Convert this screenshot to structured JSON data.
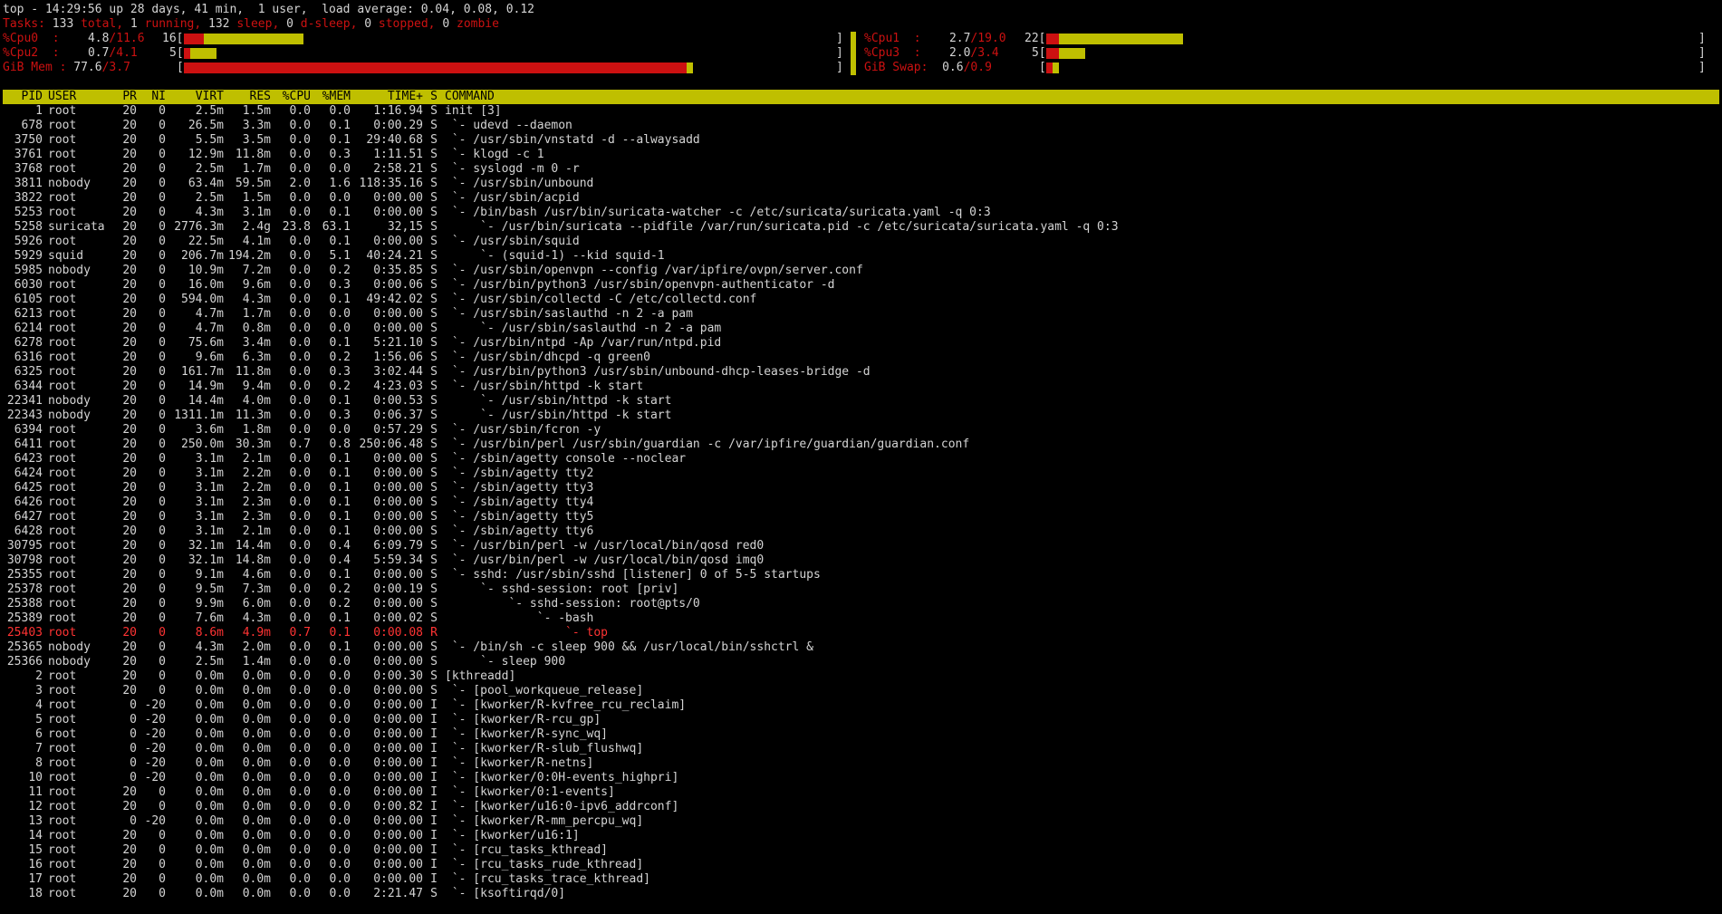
{
  "summary": {
    "uptime_line": "top - 14:29:56 up 28 days, 41 min,  1 user,  load average: 0.04, 0.08, 0.12",
    "tasks": {
      "label": "Tasks:",
      "total": "133",
      "total_l": "total,",
      "running": "1",
      "running_l": "running,",
      "sleep": "132",
      "sleep_l": "sleep,",
      "dsleep": "0",
      "dsleep_l": "d-sleep,",
      "stopped": "0",
      "stopped_l": "stopped,",
      "zombie": "0",
      "zombie_l": "zombie"
    }
  },
  "meters": {
    "cpu0": {
      "label": "%Cpu0  :",
      "value": "4.8",
      "sep": "/",
      "total": "11.6",
      "scale": "16[",
      "end": "]"
    },
    "cpu1": {
      "label": "%Cpu1  :",
      "value": "2.7",
      "sep": "/",
      "total": "19.0",
      "scale": "22[",
      "end": "]"
    },
    "cpu2": {
      "label": "%Cpu2  :",
      "value": "0.7",
      "sep": "/",
      "total": "4.1",
      "scale": "5[",
      "end": "]"
    },
    "cpu3": {
      "label": "%Cpu3  :",
      "value": "2.0",
      "sep": "/",
      "total": "3.4",
      "scale": "5[",
      "end": "]"
    },
    "mem": {
      "label": "GiB Mem :",
      "value": "77.6",
      "sep": "/",
      "total": "3.7",
      "scale": "[",
      "end": "]"
    },
    "swap": {
      "label": "GiB Swap:",
      "value": "0.6",
      "sep": "/",
      "total": "0.9",
      "scale": "[",
      "end": "]"
    }
  },
  "meter_levels": {
    "cpu0": {
      "user_frac": 0.03,
      "system_frac": 0.15
    },
    "cpu1": {
      "user_frac": 0.02,
      "system_frac": 0.19
    },
    "cpu2": {
      "user_frac": 0.01,
      "system_frac": 0.04
    },
    "cpu3": {
      "user_frac": 0.02,
      "system_frac": 0.04
    },
    "mem": {
      "user_frac": 0.76,
      "system_frac": 0.01
    },
    "swap": {
      "user_frac": 0.01,
      "system_frac": 0.01
    }
  },
  "colors": {
    "bar_red": "#cc1111",
    "bar_yellow": "#bfbf00",
    "header_bg": "#bfbf00",
    "text": "#d4d4d4",
    "current_row": "#ff3333"
  },
  "columns": [
    "PID",
    "USER",
    "PR",
    "NI",
    "VIRT",
    "RES",
    "%CPU",
    "%MEM",
    "TIME+",
    "S",
    "COMMAND"
  ],
  "processes": [
    [
      "1",
      "root",
      "20",
      "0",
      "2.5m",
      "1.5m",
      "0.0",
      "0.0",
      "1:16.94",
      "S",
      "init [3]"
    ],
    [
      "678",
      "root",
      "20",
      "0",
      "26.5m",
      "3.3m",
      "0.0",
      "0.1",
      "0:00.29",
      "S",
      " `- udevd --daemon"
    ],
    [
      "3750",
      "root",
      "20",
      "0",
      "5.5m",
      "3.5m",
      "0.0",
      "0.1",
      "29:40.68",
      "S",
      " `- /usr/sbin/vnstatd -d --alwaysadd"
    ],
    [
      "3761",
      "root",
      "20",
      "0",
      "12.9m",
      "11.8m",
      "0.0",
      "0.3",
      "1:11.51",
      "S",
      " `- klogd -c 1"
    ],
    [
      "3768",
      "root",
      "20",
      "0",
      "2.5m",
      "1.7m",
      "0.0",
      "0.0",
      "2:58.21",
      "S",
      " `- syslogd -m 0 -r"
    ],
    [
      "3811",
      "nobody",
      "20",
      "0",
      "63.4m",
      "59.5m",
      "2.0",
      "1.6",
      "118:35.16",
      "S",
      " `- /usr/sbin/unbound"
    ],
    [
      "3822",
      "root",
      "20",
      "0",
      "2.5m",
      "1.5m",
      "0.0",
      "0.0",
      "0:00.00",
      "S",
      " `- /usr/sbin/acpid"
    ],
    [
      "5253",
      "root",
      "20",
      "0",
      "4.3m",
      "3.1m",
      "0.0",
      "0.1",
      "0:00.00",
      "S",
      " `- /bin/bash /usr/bin/suricata-watcher -c /etc/suricata/suricata.yaml -q 0:3"
    ],
    [
      "5258",
      "suricata",
      "20",
      "0",
      "2776.3m",
      "2.4g",
      "23.8",
      "63.1",
      "32,15",
      "S",
      "     `- /usr/bin/suricata --pidfile /var/run/suricata.pid -c /etc/suricata/suricata.yaml -q 0:3"
    ],
    [
      "5926",
      "root",
      "20",
      "0",
      "22.5m",
      "4.1m",
      "0.0",
      "0.1",
      "0:00.00",
      "S",
      " `- /usr/sbin/squid"
    ],
    [
      "5929",
      "squid",
      "20",
      "0",
      "206.7m",
      "194.2m",
      "0.0",
      "5.1",
      "40:24.21",
      "S",
      "     `- (squid-1) --kid squid-1"
    ],
    [
      "5985",
      "nobody",
      "20",
      "0",
      "10.9m",
      "7.2m",
      "0.0",
      "0.2",
      "0:35.85",
      "S",
      " `- /usr/sbin/openvpn --config /var/ipfire/ovpn/server.conf"
    ],
    [
      "6030",
      "root",
      "20",
      "0",
      "16.0m",
      "9.6m",
      "0.0",
      "0.3",
      "0:00.06",
      "S",
      " `- /usr/bin/python3 /usr/sbin/openvpn-authenticator -d"
    ],
    [
      "6105",
      "root",
      "20",
      "0",
      "594.0m",
      "4.3m",
      "0.0",
      "0.1",
      "49:42.02",
      "S",
      " `- /usr/sbin/collectd -C /etc/collectd.conf"
    ],
    [
      "6213",
      "root",
      "20",
      "0",
      "4.7m",
      "1.7m",
      "0.0",
      "0.0",
      "0:00.00",
      "S",
      " `- /usr/sbin/saslauthd -n 2 -a pam"
    ],
    [
      "6214",
      "root",
      "20",
      "0",
      "4.7m",
      "0.8m",
      "0.0",
      "0.0",
      "0:00.00",
      "S",
      "     `- /usr/sbin/saslauthd -n 2 -a pam"
    ],
    [
      "6278",
      "root",
      "20",
      "0",
      "75.6m",
      "3.4m",
      "0.0",
      "0.1",
      "5:21.10",
      "S",
      " `- /usr/bin/ntpd -Ap /var/run/ntpd.pid"
    ],
    [
      "6316",
      "root",
      "20",
      "0",
      "9.6m",
      "6.3m",
      "0.0",
      "0.2",
      "1:56.06",
      "S",
      " `- /usr/sbin/dhcpd -q green0"
    ],
    [
      "6325",
      "root",
      "20",
      "0",
      "161.7m",
      "11.8m",
      "0.0",
      "0.3",
      "3:02.44",
      "S",
      " `- /usr/bin/python3 /usr/sbin/unbound-dhcp-leases-bridge -d"
    ],
    [
      "6344",
      "root",
      "20",
      "0",
      "14.9m",
      "9.4m",
      "0.0",
      "0.2",
      "4:23.03",
      "S",
      " `- /usr/sbin/httpd -k start"
    ],
    [
      "22341",
      "nobody",
      "20",
      "0",
      "14.4m",
      "4.0m",
      "0.0",
      "0.1",
      "0:00.53",
      "S",
      "     `- /usr/sbin/httpd -k start"
    ],
    [
      "22343",
      "nobody",
      "20",
      "0",
      "1311.1m",
      "11.3m",
      "0.0",
      "0.3",
      "0:06.37",
      "S",
      "     `- /usr/sbin/httpd -k start"
    ],
    [
      "6394",
      "root",
      "20",
      "0",
      "3.6m",
      "1.8m",
      "0.0",
      "0.0",
      "0:57.29",
      "S",
      " `- /usr/sbin/fcron -y"
    ],
    [
      "6411",
      "root",
      "20",
      "0",
      "250.0m",
      "30.3m",
      "0.7",
      "0.8",
      "250:06.48",
      "S",
      " `- /usr/bin/perl /usr/sbin/guardian -c /var/ipfire/guardian/guardian.conf"
    ],
    [
      "6423",
      "root",
      "20",
      "0",
      "3.1m",
      "2.1m",
      "0.0",
      "0.1",
      "0:00.00",
      "S",
      " `- /sbin/agetty console --noclear"
    ],
    [
      "6424",
      "root",
      "20",
      "0",
      "3.1m",
      "2.2m",
      "0.0",
      "0.1",
      "0:00.00",
      "S",
      " `- /sbin/agetty tty2"
    ],
    [
      "6425",
      "root",
      "20",
      "0",
      "3.1m",
      "2.2m",
      "0.0",
      "0.1",
      "0:00.00",
      "S",
      " `- /sbin/agetty tty3"
    ],
    [
      "6426",
      "root",
      "20",
      "0",
      "3.1m",
      "2.3m",
      "0.0",
      "0.1",
      "0:00.00",
      "S",
      " `- /sbin/agetty tty4"
    ],
    [
      "6427",
      "root",
      "20",
      "0",
      "3.1m",
      "2.3m",
      "0.0",
      "0.1",
      "0:00.00",
      "S",
      " `- /sbin/agetty tty5"
    ],
    [
      "6428",
      "root",
      "20",
      "0",
      "3.1m",
      "2.1m",
      "0.0",
      "0.1",
      "0:00.00",
      "S",
      " `- /sbin/agetty tty6"
    ],
    [
      "30795",
      "root",
      "20",
      "0",
      "32.1m",
      "14.4m",
      "0.0",
      "0.4",
      "6:09.79",
      "S",
      " `- /usr/bin/perl -w /usr/local/bin/qosd red0"
    ],
    [
      "30798",
      "root",
      "20",
      "0",
      "32.1m",
      "14.8m",
      "0.0",
      "0.4",
      "5:59.34",
      "S",
      " `- /usr/bin/perl -w /usr/local/bin/qosd imq0"
    ],
    [
      "25355",
      "root",
      "20",
      "0",
      "9.1m",
      "4.6m",
      "0.0",
      "0.1",
      "0:00.00",
      "S",
      " `- sshd: /usr/sbin/sshd [listener] 0 of 5-5 startups"
    ],
    [
      "25378",
      "root",
      "20",
      "0",
      "9.5m",
      "7.3m",
      "0.0",
      "0.2",
      "0:00.19",
      "S",
      "     `- sshd-session: root [priv]"
    ],
    [
      "25388",
      "root",
      "20",
      "0",
      "9.9m",
      "6.0m",
      "0.0",
      "0.2",
      "0:00.00",
      "S",
      "         `- sshd-session: root@pts/0"
    ],
    [
      "25389",
      "root",
      "20",
      "0",
      "7.6m",
      "4.3m",
      "0.0",
      "0.1",
      "0:00.02",
      "S",
      "             `- -bash"
    ],
    [
      "25403",
      "root",
      "20",
      "0",
      "8.6m",
      "4.9m",
      "0.7",
      "0.1",
      "0:00.08",
      "R",
      "                 `- top"
    ],
    [
      "25365",
      "nobody",
      "20",
      "0",
      "4.3m",
      "2.0m",
      "0.0",
      "0.1",
      "0:00.00",
      "S",
      " `- /bin/sh -c sleep 900 && /usr/local/bin/sshctrl &"
    ],
    [
      "25366",
      "nobody",
      "20",
      "0",
      "2.5m",
      "1.4m",
      "0.0",
      "0.0",
      "0:00.00",
      "S",
      "     `- sleep 900"
    ],
    [
      "2",
      "root",
      "20",
      "0",
      "0.0m",
      "0.0m",
      "0.0",
      "0.0",
      "0:00.30",
      "S",
      "[kthreadd]"
    ],
    [
      "3",
      "root",
      "20",
      "0",
      "0.0m",
      "0.0m",
      "0.0",
      "0.0",
      "0:00.00",
      "S",
      " `- [pool_workqueue_release]"
    ],
    [
      "4",
      "root",
      "0",
      "-20",
      "0.0m",
      "0.0m",
      "0.0",
      "0.0",
      "0:00.00",
      "I",
      " `- [kworker/R-kvfree_rcu_reclaim]"
    ],
    [
      "5",
      "root",
      "0",
      "-20",
      "0.0m",
      "0.0m",
      "0.0",
      "0.0",
      "0:00.00",
      "I",
      " `- [kworker/R-rcu_gp]"
    ],
    [
      "6",
      "root",
      "0",
      "-20",
      "0.0m",
      "0.0m",
      "0.0",
      "0.0",
      "0:00.00",
      "I",
      " `- [kworker/R-sync_wq]"
    ],
    [
      "7",
      "root",
      "0",
      "-20",
      "0.0m",
      "0.0m",
      "0.0",
      "0.0",
      "0:00.00",
      "I",
      " `- [kworker/R-slub_flushwq]"
    ],
    [
      "8",
      "root",
      "0",
      "-20",
      "0.0m",
      "0.0m",
      "0.0",
      "0.0",
      "0:00.00",
      "I",
      " `- [kworker/R-netns]"
    ],
    [
      "10",
      "root",
      "0",
      "-20",
      "0.0m",
      "0.0m",
      "0.0",
      "0.0",
      "0:00.00",
      "I",
      " `- [kworker/0:0H-events_highpri]"
    ],
    [
      "11",
      "root",
      "20",
      "0",
      "0.0m",
      "0.0m",
      "0.0",
      "0.0",
      "0:00.00",
      "I",
      " `- [kworker/0:1-events]"
    ],
    [
      "12",
      "root",
      "20",
      "0",
      "0.0m",
      "0.0m",
      "0.0",
      "0.0",
      "0:00.82",
      "I",
      " `- [kworker/u16:0-ipv6_addrconf]"
    ],
    [
      "13",
      "root",
      "0",
      "-20",
      "0.0m",
      "0.0m",
      "0.0",
      "0.0",
      "0:00.00",
      "I",
      " `- [kworker/R-mm_percpu_wq]"
    ],
    [
      "14",
      "root",
      "20",
      "0",
      "0.0m",
      "0.0m",
      "0.0",
      "0.0",
      "0:00.00",
      "I",
      " `- [kworker/u16:1]"
    ],
    [
      "15",
      "root",
      "20",
      "0",
      "0.0m",
      "0.0m",
      "0.0",
      "0.0",
      "0:00.00",
      "I",
      " `- [rcu_tasks_kthread]"
    ],
    [
      "16",
      "root",
      "20",
      "0",
      "0.0m",
      "0.0m",
      "0.0",
      "0.0",
      "0:00.00",
      "I",
      " `- [rcu_tasks_rude_kthread]"
    ],
    [
      "17",
      "root",
      "20",
      "0",
      "0.0m",
      "0.0m",
      "0.0",
      "0.0",
      "0:00.00",
      "I",
      " `- [rcu_tasks_trace_kthread]"
    ],
    [
      "18",
      "root",
      "20",
      "0",
      "0.0m",
      "0.0m",
      "0.0",
      "0.0",
      "2:21.47",
      "S",
      " `- [ksoftirqd/0]"
    ]
  ],
  "current_pid": "25403"
}
